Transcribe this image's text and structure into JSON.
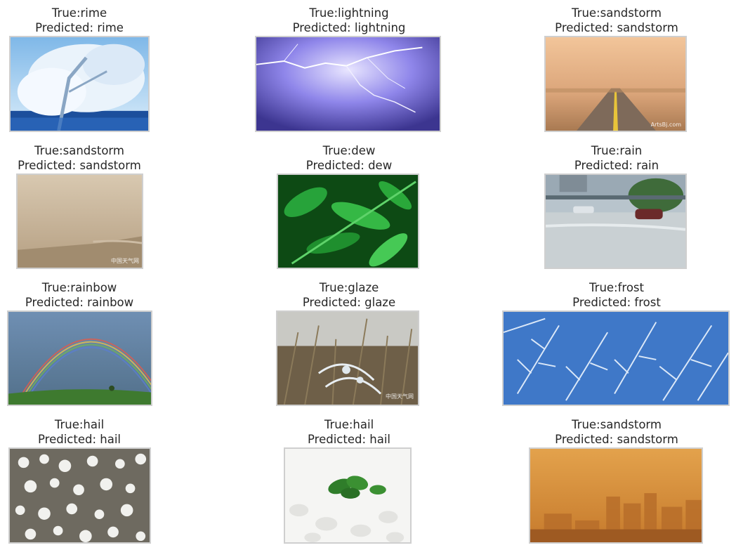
{
  "panels": [
    {
      "true_label": "True:rime",
      "pred_label": "Predicted: rime",
      "image": "rime-photo"
    },
    {
      "true_label": "True:lightning",
      "pred_label": "Predicted: lightning",
      "image": "lightning-photo"
    },
    {
      "true_label": "True:sandstorm",
      "pred_label": "Predicted: sandstorm",
      "image": "sandstorm-road-photo",
      "watermark": "ArtsBj.com"
    },
    {
      "true_label": "True:sandstorm",
      "pred_label": "Predicted: sandstorm",
      "image": "sandstorm-haze-photo",
      "watermark": "中国天气网"
    },
    {
      "true_label": "True:dew",
      "pred_label": "Predicted: dew",
      "image": "dew-photo"
    },
    {
      "true_label": "True:rain",
      "pred_label": "Predicted: rain",
      "image": "rain-flood-photo"
    },
    {
      "true_label": "True:rainbow",
      "pred_label": "Predicted: rainbow",
      "image": "rainbow-photo"
    },
    {
      "true_label": "True:glaze",
      "pred_label": "Predicted: glaze",
      "image": "glaze-photo",
      "watermark": "中国天气网"
    },
    {
      "true_label": "True:frost",
      "pred_label": "Predicted: frost",
      "image": "frost-photo"
    },
    {
      "true_label": "True:hail",
      "pred_label": "Predicted: hail",
      "image": "hail-ground-photo"
    },
    {
      "true_label": "True:hail",
      "pred_label": "Predicted: hail",
      "image": "hail-plant-photo"
    },
    {
      "true_label": "True:sandstorm",
      "pred_label": "Predicted: sandstorm",
      "image": "sandstorm-city-photo"
    }
  ]
}
